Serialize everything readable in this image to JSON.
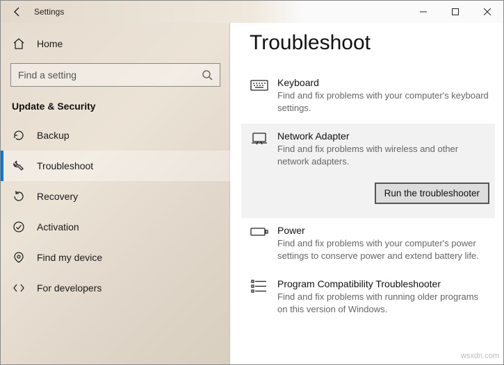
{
  "window": {
    "title": "Settings"
  },
  "sidebar": {
    "home": "Home",
    "search_placeholder": "Find a setting",
    "section": "Update & Security",
    "items": [
      {
        "label": "Backup"
      },
      {
        "label": "Troubleshoot"
      },
      {
        "label": "Recovery"
      },
      {
        "label": "Activation"
      },
      {
        "label": "Find my device"
      },
      {
        "label": "For developers"
      }
    ]
  },
  "main": {
    "heading": "Troubleshoot",
    "items": [
      {
        "title": "Keyboard",
        "desc": "Find and fix problems with your computer's keyboard settings."
      },
      {
        "title": "Network Adapter",
        "desc": "Find and fix problems with wireless and other network adapters.",
        "button": "Run the troubleshooter"
      },
      {
        "title": "Power",
        "desc": "Find and fix problems with your computer's power settings to conserve power and extend battery life."
      },
      {
        "title": "Program Compatibility Troubleshooter",
        "desc": "Find and fix problems with running older programs on this version of Windows."
      }
    ]
  },
  "watermark": "wsxdn.com"
}
